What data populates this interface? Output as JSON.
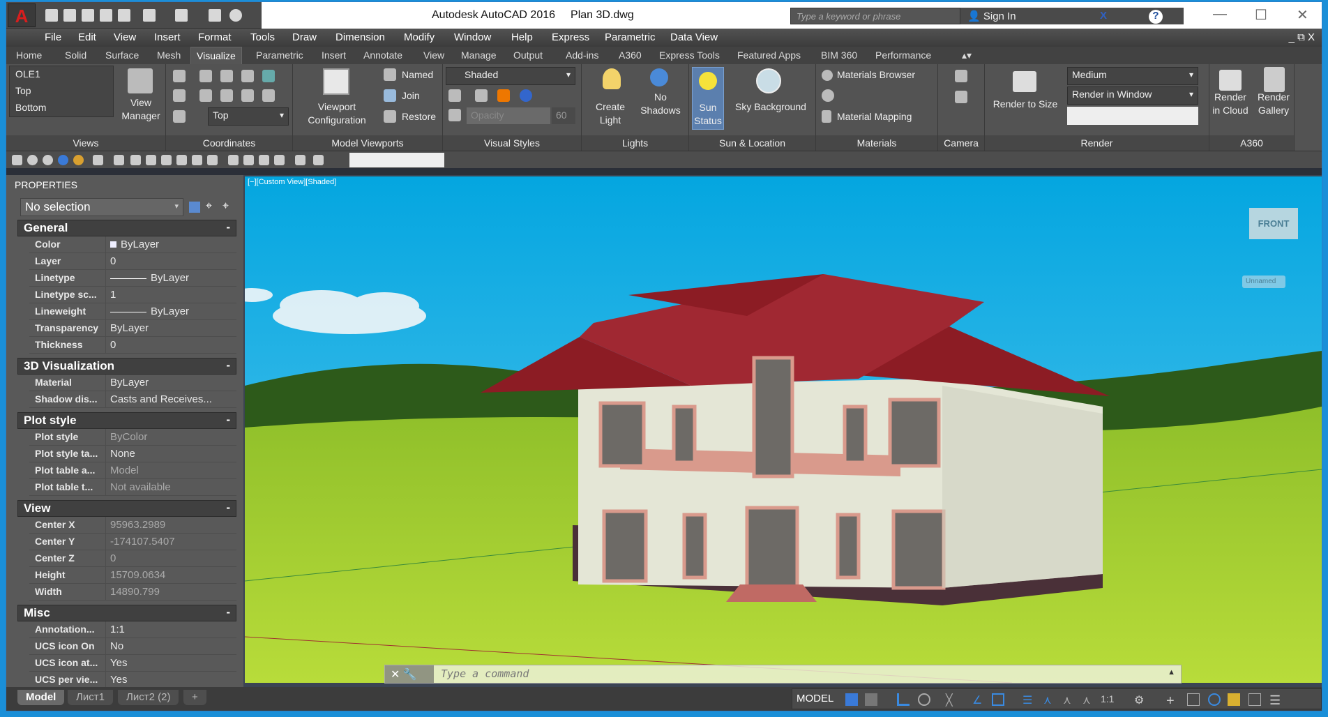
{
  "window": {
    "app": "Autodesk AutoCAD 2016",
    "file": "Plan 3D.dwg",
    "search_placeholder": "Type a keyword or phrase",
    "sign_in": "Sign In"
  },
  "menu": [
    "File",
    "Edit",
    "View",
    "Insert",
    "Format",
    "Tools",
    "Draw",
    "Dimension",
    "Modify",
    "Window",
    "Help",
    "Express",
    "Parametric",
    "Data View"
  ],
  "ribbon_tabs": [
    "Home",
    "Solid",
    "Surface",
    "Mesh",
    "Visualize",
    "Parametric",
    "Insert",
    "Annotate",
    "View",
    "Manage",
    "Output",
    "Add-ins",
    "A360",
    "Express Tools",
    "Featured Apps",
    "BIM 360",
    "Performance"
  ],
  "active_tab": "Visualize",
  "ribbon": {
    "views": {
      "label": "Views",
      "items": [
        "OLE1",
        "Top",
        "Bottom"
      ],
      "view_manager": "View Manager"
    },
    "coordinates": {
      "label": "Coordinates",
      "ucs_select": "Top"
    },
    "model_viewports": {
      "label": "Model Viewports",
      "viewport_config": "Viewport Configuration",
      "named": "Named",
      "join": "Join",
      "restore": "Restore"
    },
    "visual_styles": {
      "label": "Visual Styles",
      "style": "Shaded",
      "opacity_placeholder": "Opacity",
      "opacity_value": "60"
    },
    "lights": {
      "label": "Lights",
      "create_light": "Create Light",
      "no_shadows": "No Shadows"
    },
    "sun": {
      "label": "Sun & Location",
      "sun_status": "Sun Status",
      "sky_background": "Sky Background"
    },
    "materials": {
      "label": "Materials",
      "browser": "Materials Browser",
      "mapping": "Material Mapping"
    },
    "camera": {
      "label": "Camera"
    },
    "render": {
      "label": "Render",
      "render_to_size": "Render to Size",
      "quality": "Medium",
      "target": "Render in Window"
    },
    "a360": {
      "label": "A360",
      "render_cloud": "Render in Cloud",
      "render_gallery": "Render Gallery"
    }
  },
  "properties": {
    "title": "PROPERTIES",
    "selection": "No selection",
    "sections": [
      {
        "name": "General",
        "rows": [
          [
            "Color",
            "ByLayer"
          ],
          [
            "Layer",
            "0"
          ],
          [
            "Linetype",
            "ByLayer"
          ],
          [
            "Linetype sc...",
            "1"
          ],
          [
            "Lineweight",
            "ByLayer"
          ],
          [
            "Transparency",
            "ByLayer"
          ],
          [
            "Thickness",
            "0"
          ]
        ]
      },
      {
        "name": "3D Visualization",
        "rows": [
          [
            "Material",
            "ByLayer"
          ],
          [
            "Shadow dis...",
            "Casts and Receives..."
          ]
        ]
      },
      {
        "name": "Plot style",
        "rows": [
          [
            "Plot style",
            "ByColor"
          ],
          [
            "Plot style ta...",
            "None"
          ],
          [
            "Plot table a...",
            "Model"
          ],
          [
            "Plot table t...",
            "Not available"
          ]
        ]
      },
      {
        "name": "View",
        "rows": [
          [
            "Center X",
            "95963.2989"
          ],
          [
            "Center Y",
            "-174107.5407"
          ],
          [
            "Center Z",
            "0"
          ],
          [
            "Height",
            "15709.0634"
          ],
          [
            "Width",
            "14890.799"
          ]
        ]
      },
      {
        "name": "Misc",
        "rows": [
          [
            "Annotation...",
            "1:1"
          ],
          [
            "UCS icon On",
            "No"
          ],
          [
            "UCS icon at...",
            "Yes"
          ],
          [
            "UCS per vie...",
            "Yes"
          ]
        ]
      }
    ]
  },
  "viewport": {
    "label": "[−][Custom View][Shaded]",
    "viewcube_face": "FRONT",
    "ucs_name": "Unnamed"
  },
  "command": {
    "placeholder": "Type a command"
  },
  "layout_tabs": [
    "Model",
    "Лист1",
    "Лист2 (2)",
    "+"
  ],
  "status": {
    "model": "MODEL",
    "scale": "1:1"
  },
  "colors": {
    "accent": "#1a8fd8",
    "roof": "#8c1c24",
    "wall": "#e4e6d6",
    "trim": "#d99a8c",
    "sun_active": "#5b7fae"
  }
}
